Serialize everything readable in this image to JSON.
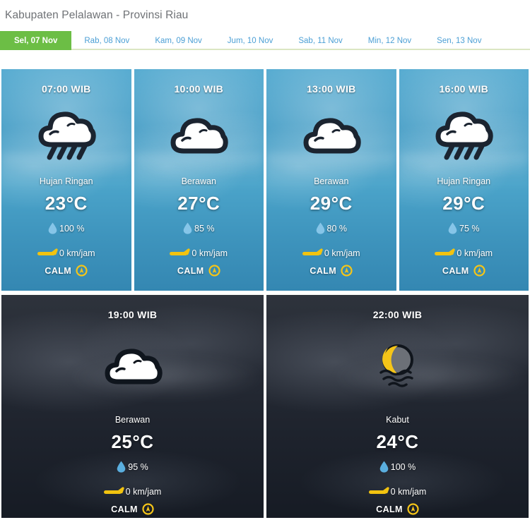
{
  "header": {
    "title": "Kabupaten Pelalawan - Provinsi Riau"
  },
  "tabs": {
    "items": [
      {
        "label": "Sel, 07 Nov",
        "active": true
      },
      {
        "label": "Rab, 08 Nov",
        "active": false
      },
      {
        "label": "Kam, 09 Nov",
        "active": false
      },
      {
        "label": "Jum, 10 Nov",
        "active": false
      },
      {
        "label": "Sab, 11 Nov",
        "active": false
      },
      {
        "label": "Min, 12 Nov",
        "active": false
      },
      {
        "label": "Sen, 13 Nov",
        "active": false
      }
    ],
    "active_color": "#6cbe45",
    "link_color": "#4b9fd5"
  },
  "forecast": {
    "cards": [
      {
        "time": "07:00 WIB",
        "icon": "rain-cloud-icon",
        "condition": "Hujan Ringan",
        "temperature": "23°C",
        "humidity": "100 %",
        "wind_speed": "0 km/jam",
        "wind_direction": "CALM",
        "period": "day"
      },
      {
        "time": "10:00 WIB",
        "icon": "cloud-icon",
        "condition": "Berawan",
        "temperature": "27°C",
        "humidity": "85 %",
        "wind_speed": "0 km/jam",
        "wind_direction": "CALM",
        "period": "day"
      },
      {
        "time": "13:00 WIB",
        "icon": "cloud-icon",
        "condition": "Berawan",
        "temperature": "29°C",
        "humidity": "80 %",
        "wind_speed": "0 km/jam",
        "wind_direction": "CALM",
        "period": "day"
      },
      {
        "time": "16:00 WIB",
        "icon": "rain-cloud-icon",
        "condition": "Hujan Ringan",
        "temperature": "29°C",
        "humidity": "75 %",
        "wind_speed": "0 km/jam",
        "wind_direction": "CALM",
        "period": "day"
      },
      {
        "time": "19:00 WIB",
        "icon": "cloud-icon",
        "condition": "Berawan",
        "temperature": "25°C",
        "humidity": "95 %",
        "wind_speed": "0 km/jam",
        "wind_direction": "CALM",
        "period": "night"
      },
      {
        "time": "22:00 WIB",
        "icon": "moon-fog-icon",
        "condition": "Kabut",
        "temperature": "24°C",
        "humidity": "100 %",
        "wind_speed": "0 km/jam",
        "wind_direction": "CALM",
        "period": "night"
      }
    ]
  },
  "colors": {
    "droplet": "#86c5e8",
    "wind": "#f2c310",
    "compass": "#f5c518",
    "title_text": "#6f7276",
    "day_sky": "#459ec6",
    "night_sky": "#232831"
  }
}
